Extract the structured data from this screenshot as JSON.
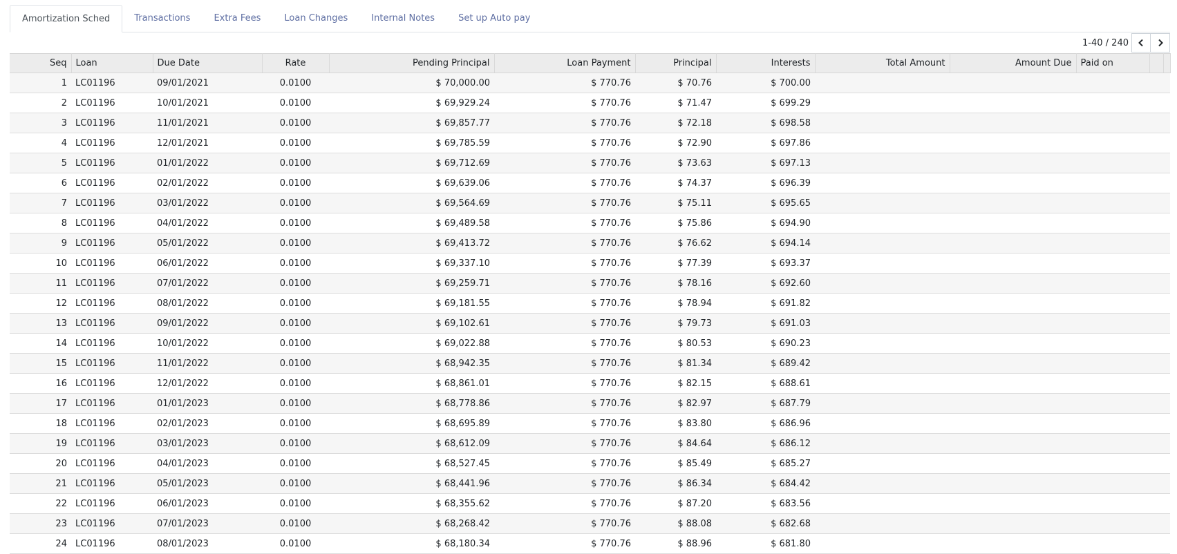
{
  "tabs": [
    {
      "label": "Amortization Sched",
      "active": true
    },
    {
      "label": "Transactions",
      "active": false
    },
    {
      "label": "Extra Fees",
      "active": false
    },
    {
      "label": "Loan Changes",
      "active": false
    },
    {
      "label": "Internal Notes",
      "active": false
    },
    {
      "label": "Set up Auto pay",
      "active": false
    }
  ],
  "pager": {
    "value": "1-40 / 240",
    "prev_icon": "chevron-left-icon",
    "next_icon": "chevron-right-icon"
  },
  "table": {
    "headers": [
      "Seq",
      "Loan",
      "Due Date",
      "Rate",
      "Pending Principal",
      "Loan Payment",
      "Principal",
      "Interests",
      "Total Amount",
      "Amount Due",
      "Paid on"
    ],
    "rows": [
      [
        "1",
        "LC01196",
        "09/01/2021",
        "0.0100",
        "$ 70,000.00",
        "$ 770.76",
        "$ 70.76",
        "$ 700.00"
      ],
      [
        "2",
        "LC01196",
        "10/01/2021",
        "0.0100",
        "$ 69,929.24",
        "$ 770.76",
        "$ 71.47",
        "$ 699.29"
      ],
      [
        "3",
        "LC01196",
        "11/01/2021",
        "0.0100",
        "$ 69,857.77",
        "$ 770.76",
        "$ 72.18",
        "$ 698.58"
      ],
      [
        "4",
        "LC01196",
        "12/01/2021",
        "0.0100",
        "$ 69,785.59",
        "$ 770.76",
        "$ 72.90",
        "$ 697.86"
      ],
      [
        "5",
        "LC01196",
        "01/01/2022",
        "0.0100",
        "$ 69,712.69",
        "$ 770.76",
        "$ 73.63",
        "$ 697.13"
      ],
      [
        "6",
        "LC01196",
        "02/01/2022",
        "0.0100",
        "$ 69,639.06",
        "$ 770.76",
        "$ 74.37",
        "$ 696.39"
      ],
      [
        "7",
        "LC01196",
        "03/01/2022",
        "0.0100",
        "$ 69,564.69",
        "$ 770.76",
        "$ 75.11",
        "$ 695.65"
      ],
      [
        "8",
        "LC01196",
        "04/01/2022",
        "0.0100",
        "$ 69,489.58",
        "$ 770.76",
        "$ 75.86",
        "$ 694.90"
      ],
      [
        "9",
        "LC01196",
        "05/01/2022",
        "0.0100",
        "$ 69,413.72",
        "$ 770.76",
        "$ 76.62",
        "$ 694.14"
      ],
      [
        "10",
        "LC01196",
        "06/01/2022",
        "0.0100",
        "$ 69,337.10",
        "$ 770.76",
        "$ 77.39",
        "$ 693.37"
      ],
      [
        "11",
        "LC01196",
        "07/01/2022",
        "0.0100",
        "$ 69,259.71",
        "$ 770.76",
        "$ 78.16",
        "$ 692.60"
      ],
      [
        "12",
        "LC01196",
        "08/01/2022",
        "0.0100",
        "$ 69,181.55",
        "$ 770.76",
        "$ 78.94",
        "$ 691.82"
      ],
      [
        "13",
        "LC01196",
        "09/01/2022",
        "0.0100",
        "$ 69,102.61",
        "$ 770.76",
        "$ 79.73",
        "$ 691.03"
      ],
      [
        "14",
        "LC01196",
        "10/01/2022",
        "0.0100",
        "$ 69,022.88",
        "$ 770.76",
        "$ 80.53",
        "$ 690.23"
      ],
      [
        "15",
        "LC01196",
        "11/01/2022",
        "0.0100",
        "$ 68,942.35",
        "$ 770.76",
        "$ 81.34",
        "$ 689.42"
      ],
      [
        "16",
        "LC01196",
        "12/01/2022",
        "0.0100",
        "$ 68,861.01",
        "$ 770.76",
        "$ 82.15",
        "$ 688.61"
      ],
      [
        "17",
        "LC01196",
        "01/01/2023",
        "0.0100",
        "$ 68,778.86",
        "$ 770.76",
        "$ 82.97",
        "$ 687.79"
      ],
      [
        "18",
        "LC01196",
        "02/01/2023",
        "0.0100",
        "$ 68,695.89",
        "$ 770.76",
        "$ 83.80",
        "$ 686.96"
      ],
      [
        "19",
        "LC01196",
        "03/01/2023",
        "0.0100",
        "$ 68,612.09",
        "$ 770.76",
        "$ 84.64",
        "$ 686.12"
      ],
      [
        "20",
        "LC01196",
        "04/01/2023",
        "0.0100",
        "$ 68,527.45",
        "$ 770.76",
        "$ 85.49",
        "$ 685.27"
      ],
      [
        "21",
        "LC01196",
        "05/01/2023",
        "0.0100",
        "$ 68,441.96",
        "$ 770.76",
        "$ 86.34",
        "$ 684.42"
      ],
      [
        "22",
        "LC01196",
        "06/01/2023",
        "0.0100",
        "$ 68,355.62",
        "$ 770.76",
        "$ 87.20",
        "$ 683.56"
      ],
      [
        "23",
        "LC01196",
        "07/01/2023",
        "0.0100",
        "$ 68,268.42",
        "$ 770.76",
        "$ 88.08",
        "$ 682.68"
      ],
      [
        "24",
        "LC01196",
        "08/01/2023",
        "0.0100",
        "$ 68,180.34",
        "$ 770.76",
        "$ 88.96",
        "$ 681.80"
      ]
    ]
  }
}
